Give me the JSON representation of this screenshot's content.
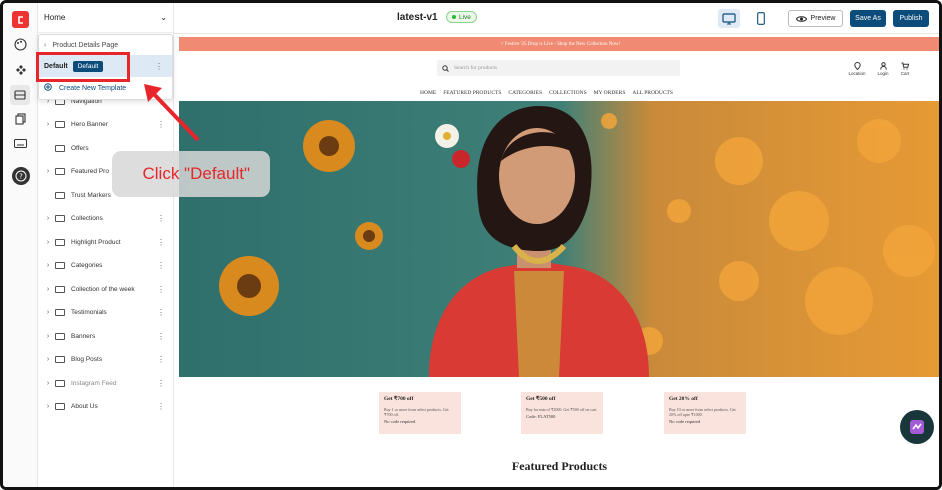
{
  "app": {
    "page_selector": "Home",
    "template_title": "latest-v1",
    "status": "Live",
    "buttons": {
      "preview": "Preview",
      "save_as": "Save As",
      "publish": "Publish"
    }
  },
  "dropdown": {
    "back_label": "Product Details Page",
    "current_template": "Default",
    "badge": "Default",
    "create_new": "Create New Template"
  },
  "sections": [
    {
      "label": "Navigation",
      "expandable": true,
      "muted": false
    },
    {
      "label": "Hero Banner",
      "expandable": true,
      "muted": false
    },
    {
      "label": "Offers",
      "expandable": false,
      "muted": false
    },
    {
      "label": "Featured Pro",
      "expandable": true,
      "muted": false
    },
    {
      "label": "Trust Markers",
      "expandable": false,
      "muted": false
    },
    {
      "label": "Collections",
      "expandable": true,
      "muted": false
    },
    {
      "label": "Highlight Product",
      "expandable": true,
      "muted": false
    },
    {
      "label": "Categories",
      "expandable": true,
      "muted": false
    },
    {
      "label": "Collection of the week",
      "expandable": true,
      "muted": false
    },
    {
      "label": "Testimonials",
      "expandable": true,
      "muted": false
    },
    {
      "label": "Banners",
      "expandable": true,
      "muted": false
    },
    {
      "label": "Blog Posts",
      "expandable": true,
      "muted": false
    },
    {
      "label": "Instagram Feed",
      "expandable": true,
      "muted": true
    },
    {
      "label": "About Us",
      "expandable": true,
      "muted": false
    }
  ],
  "annotation": {
    "text": "Click \"Default\""
  },
  "store": {
    "promo_text": "> Festive '25 Drop is Live - Shop the New Collection Now!",
    "search_placeholder": "Search for products",
    "top_icons": [
      "Location",
      "Login",
      "Cart"
    ],
    "nav": [
      "HOME",
      "FEATURED PRODUCTS",
      "CATEGORIES",
      "COLLECTIONS",
      "MY ORDERS",
      "ALL PRODUCTS"
    ],
    "offers": [
      {
        "title": "Get ₹700 off",
        "desc": "Buy 1 or more from select products. Get ₹700 off.",
        "note": "No code required"
      },
      {
        "title": "Get ₹500 off",
        "desc": "Buy for min of ₹2000. Get ₹500 off on cart.",
        "note": "Code: FLAT500"
      },
      {
        "title": "Get 20% off",
        "desc": "Buy 10 or more from select products. Get 20% off upto ₹1000.",
        "note": "No code required"
      }
    ],
    "featured_heading": "Featured Products"
  },
  "colors": {
    "accent": "#0b4c7a",
    "annotation": "#e6262a",
    "promo": "#f08a72"
  }
}
